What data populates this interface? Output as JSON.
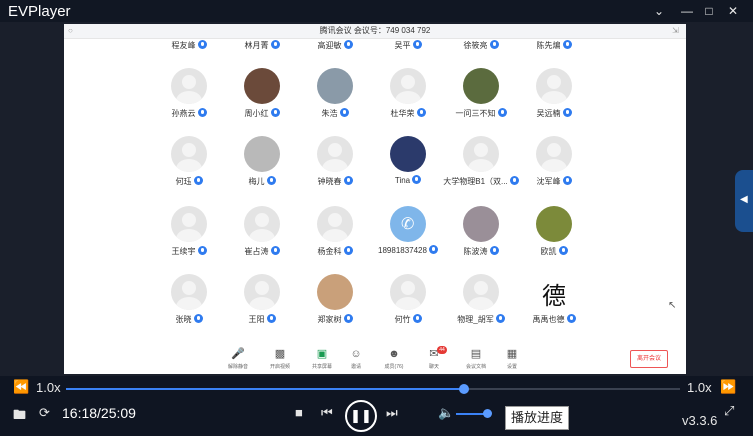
{
  "app": {
    "title": "EVPlayer",
    "version": "v3.3.6"
  },
  "window": {
    "minimize_icon": "minimize-icon",
    "maximize_icon": "maximize-icon",
    "close_icon": "close-icon",
    "chevron_icon": "chevron-down-icon"
  },
  "meeting": {
    "title": "腾讯会议 会议号：749 034 792"
  },
  "participants_top": [
    {
      "name": "程友峰"
    },
    {
      "name": "林月菁"
    },
    {
      "name": "高迎敏"
    },
    {
      "name": "吴平"
    },
    {
      "name": "徐筱亮"
    },
    {
      "name": "陈先煸"
    }
  ],
  "participants": [
    {
      "name": "孙燕云"
    },
    {
      "name": "周小红"
    },
    {
      "name": "朱浩"
    },
    {
      "name": "杜华荣"
    },
    {
      "name": "一问三不知"
    },
    {
      "name": "吴远楠"
    },
    {
      "name": "何珏"
    },
    {
      "name": "梅儿"
    },
    {
      "name": "钟晓春"
    },
    {
      "name": "Tina"
    },
    {
      "name": "大学物理B1（双..."
    },
    {
      "name": "沈军峰"
    },
    {
      "name": "王续宇"
    },
    {
      "name": "崔占涛"
    },
    {
      "name": "杨金科"
    },
    {
      "name": "18981837428"
    },
    {
      "name": "陈波涛"
    },
    {
      "name": "欧凯"
    },
    {
      "name": "张晓"
    },
    {
      "name": "王阳"
    },
    {
      "name": "郑家树"
    },
    {
      "name": "何竹"
    },
    {
      "name": "物理_胡军"
    },
    {
      "name": "禹禹也德"
    }
  ],
  "meeting_toolbar": {
    "items": [
      "解除静音",
      "开启视频",
      "共享屏幕",
      "邀请",
      "成员(76)",
      "聊天",
      "会议文档",
      "设置"
    ],
    "chat_badge": "44",
    "leave": "离开会议"
  },
  "player": {
    "speed_left": "1.0x",
    "speed_right": "1.0x",
    "time": "16:18/25:09",
    "progress": 0.648,
    "volume": 0.9,
    "tooltip": "播放进度"
  },
  "colors": {
    "accent": "#3b82f6",
    "background": "#0f1522",
    "mic": "#2f7bef"
  }
}
